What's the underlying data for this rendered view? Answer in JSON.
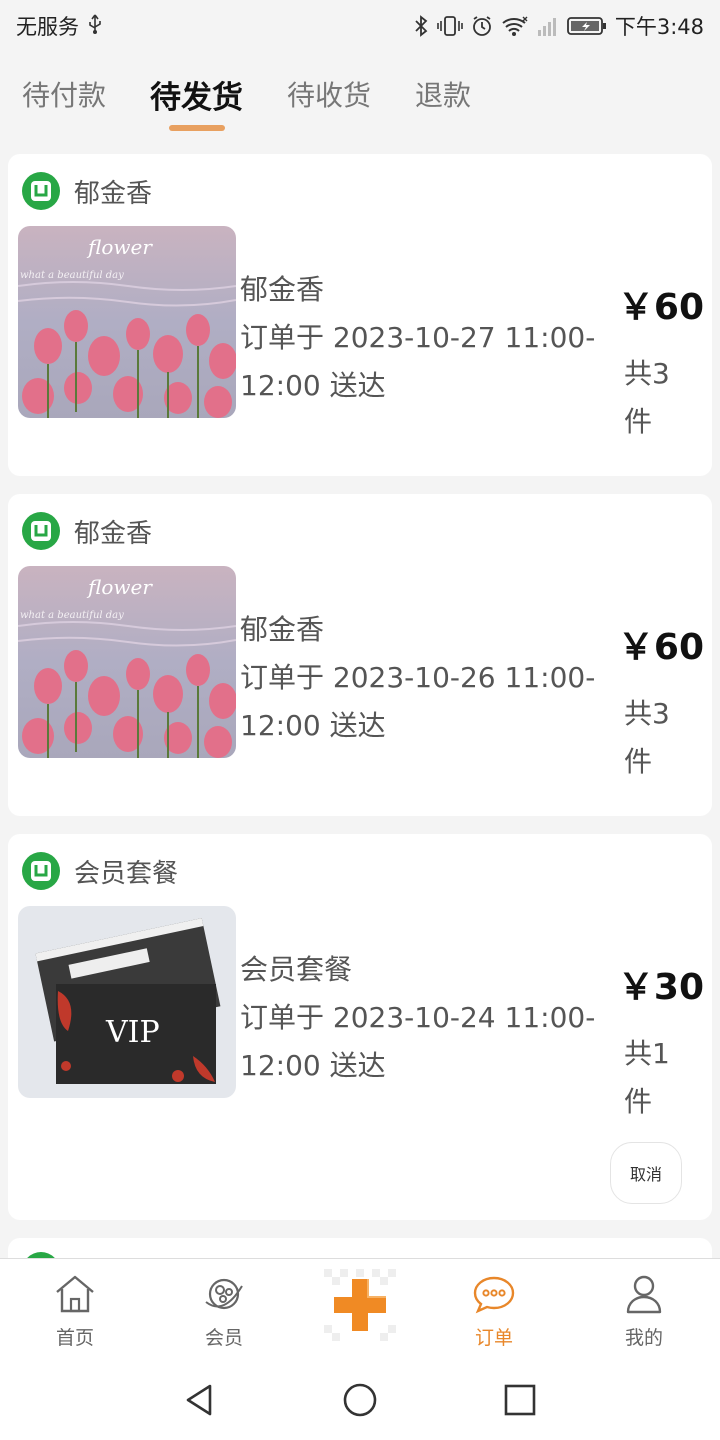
{
  "status_bar": {
    "carrier": "无服务",
    "time": "下午3:48"
  },
  "tabs": [
    {
      "label": "待付款",
      "active": false
    },
    {
      "label": "待发货",
      "active": true
    },
    {
      "label": "待收货",
      "active": false
    },
    {
      "label": "退款",
      "active": false
    }
  ],
  "orders": [
    {
      "store_name": "郁金香",
      "product_name": "郁金香",
      "order_desc": "订单于 2023-10-27 11:00-12:00 送达",
      "price": "￥60",
      "qty": "共3件",
      "image_text": "flower",
      "image_subtext": "what a beautiful day"
    },
    {
      "store_name": "郁金香",
      "product_name": "郁金香",
      "order_desc": "订单于 2023-10-26 11:00-12:00 送达",
      "price": "￥60",
      "qty": "共3件",
      "image_text": "flower",
      "image_subtext": "what a beautiful day"
    },
    {
      "store_name": "会员套餐",
      "product_name": "会员套餐",
      "order_desc": "订单于 2023-10-24 11:00-12:00 送达",
      "price": "￥30",
      "qty": "共1件",
      "image_text": "VIP",
      "cancel_label": "取消"
    }
  ],
  "bottom_nav": [
    {
      "label": "首页",
      "icon": "home-icon",
      "active": false
    },
    {
      "label": "会员",
      "icon": "member-icon",
      "active": false
    },
    {
      "label": "",
      "icon": "plus-icon",
      "active": false
    },
    {
      "label": "订单",
      "icon": "order-chat-icon",
      "active": true
    },
    {
      "label": "我的",
      "icon": "user-icon",
      "active": false
    }
  ],
  "colors": {
    "accent": "#e8872a",
    "tab_indicator": "#e8a060",
    "store_logo": "#28a745"
  }
}
